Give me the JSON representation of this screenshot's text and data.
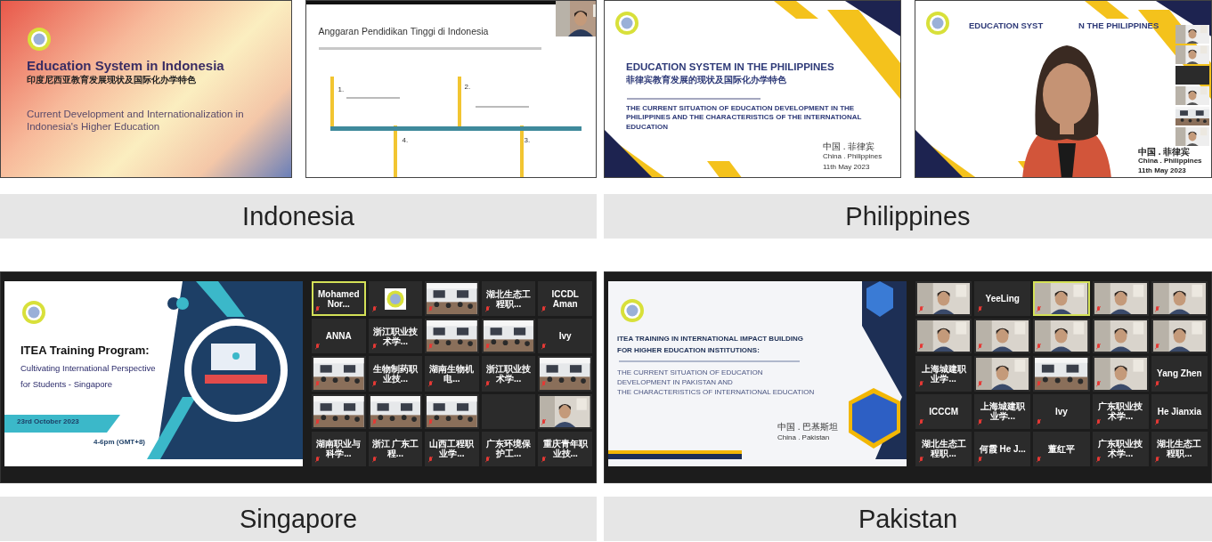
{
  "panels": [
    {
      "caption": "Indonesia",
      "frames": [
        {
          "kind": "gradient-title",
          "title": "Education System in Indonesia",
          "title_cn": "印度尼西亚教育发展现状及国际化办学特色",
          "subtitle": "Current Development and Internationalization in Indonesia's Higher Education"
        },
        {
          "kind": "timeline",
          "title": "Anggaran Pendidikan Tinggi di Indonesia",
          "steps": [
            "1.",
            "2.",
            "4.",
            "3."
          ]
        }
      ]
    },
    {
      "caption": "Philippines",
      "frames": [
        {
          "kind": "banner-title",
          "title": "EDUCATION SYSTEM IN THE PHILIPPINES",
          "title_cn": "菲律宾教育发展的现状及国际化办学特色",
          "subtitle": "THE CURRENT SITUATION OF EDUCATION DEVELOPMENT IN THE PHILIPPINES AND THE CHARACTERISTICS OF THE INTERNATIONAL EDUCATION",
          "footer": [
            "中国 . 菲律宾",
            "China . Philippines",
            "11th May 2023"
          ]
        },
        {
          "kind": "speaker",
          "title": "EDUCATION SYST",
          "title_end": "N THE PHILIPPINES",
          "footer": [
            "中国 . 菲律宾",
            "China . Philippines",
            "11th May 2023"
          ]
        }
      ]
    },
    {
      "caption": "Singapore",
      "frames": [
        {
          "kind": "meeting",
          "slide": {
            "kind": "program",
            "title": "ITEA Training Program:",
            "lines": [
              "Cultivating International Perspective",
              "for Students - Singapore"
            ],
            "date": "23rd October 2023",
            "time": "4-6pm (GMT+8)"
          },
          "tiles": [
            {
              "kind": "name",
              "name": "Mohamed Nor...",
              "highlighted": true
            },
            {
              "kind": "logo",
              "highlighted": false
            },
            {
              "kind": "room",
              "highlighted": false
            },
            {
              "kind": "name",
              "name": "湖北生态工程职...",
              "highlighted": false
            },
            {
              "kind": "name",
              "name": "ICCDL Aman",
              "highlighted": false
            },
            {
              "kind": "name",
              "name": "ANNA",
              "highlighted": false
            },
            {
              "kind": "name",
              "name": "浙江职业技术学...",
              "highlighted": false
            },
            {
              "kind": "room",
              "highlighted": false
            },
            {
              "kind": "room",
              "highlighted": false
            },
            {
              "kind": "name",
              "name": "Ivy",
              "highlighted": false
            },
            {
              "kind": "room",
              "highlighted": false
            },
            {
              "kind": "name",
              "name": "生物制药职业技...",
              "highlighted": false
            },
            {
              "kind": "name",
              "name": "湖南生物机电...",
              "highlighted": false
            },
            {
              "kind": "name",
              "name": "浙江职业技术学...",
              "highlighted": false
            },
            {
              "kind": "room",
              "highlighted": false
            },
            {
              "kind": "room",
              "highlighted": false
            },
            {
              "kind": "room",
              "highlighted": false
            },
            {
              "kind": "room",
              "highlighted": false
            },
            {
              "kind": "empty",
              "highlighted": false
            },
            {
              "kind": "person",
              "highlighted": false
            },
            {
              "kind": "name",
              "name": "湖南职业与科学...",
              "highlighted": false
            },
            {
              "kind": "name",
              "name": "浙江 广东工程...",
              "highlighted": false
            },
            {
              "kind": "name",
              "name": "山西工程职业学...",
              "highlighted": false
            },
            {
              "kind": "name",
              "name": "广东环境保护工...",
              "highlighted": false
            },
            {
              "kind": "name",
              "name": "重庆青年职业技...",
              "highlighted": false
            }
          ]
        }
      ]
    },
    {
      "caption": "Pakistan",
      "frames": [
        {
          "kind": "meeting",
          "slide": {
            "kind": "impact",
            "title": "ITEA TRAINING IN INTERNATIONAL IMPACT BUILDING",
            "title2": "FOR HIGHER EDUCATION INSTITUTIONS:",
            "lines": [
              "THE CURRENT SITUATION OF EDUCATION",
              "DEVELOPMENT IN PAKISTAN AND",
              "THE CHARACTERISTICS OF INTERNATIONAL EDUCATION"
            ],
            "footer": [
              "中国 . 巴基斯坦",
              "China . Pakistan"
            ]
          },
          "tiles": [
            {
              "kind": "person",
              "highlighted": false
            },
            {
              "kind": "name",
              "name": "YeeLing",
              "highlighted": false
            },
            {
              "kind": "person",
              "highlighted": true
            },
            {
              "kind": "person",
              "highlighted": false
            },
            {
              "kind": "person",
              "highlighted": false
            },
            {
              "kind": "person",
              "highlighted": false
            },
            {
              "kind": "person",
              "highlighted": false
            },
            {
              "kind": "person",
              "highlighted": false
            },
            {
              "kind": "person",
              "highlighted": false
            },
            {
              "kind": "person",
              "highlighted": false
            },
            {
              "kind": "name",
              "name": "上海城建职业学...",
              "highlighted": false
            },
            {
              "kind": "person",
              "highlighted": false
            },
            {
              "kind": "room",
              "highlighted": false
            },
            {
              "kind": "person",
              "highlighted": false
            },
            {
              "kind": "name",
              "name": "Yang Zhen",
              "highlighted": false
            },
            {
              "kind": "name",
              "name": "ICCCM",
              "highlighted": false
            },
            {
              "kind": "name",
              "name": "上海城建职业学...",
              "highlighted": false
            },
            {
              "kind": "name",
              "name": "Ivy",
              "highlighted": false
            },
            {
              "kind": "name",
              "name": "广东职业技术学...",
              "highlighted": false
            },
            {
              "kind": "name",
              "name": "He Jianxia",
              "highlighted": false
            },
            {
              "kind": "name",
              "name": "湖北生态工程职...",
              "highlighted": false
            },
            {
              "kind": "name",
              "name": "何霞 He J...",
              "highlighted": false
            },
            {
              "kind": "name",
              "name": "董红平",
              "highlighted": false
            },
            {
              "kind": "name",
              "name": "广东职业技术学...",
              "highlighted": false
            },
            {
              "kind": "name",
              "name": "湖北生态工程职...",
              "highlighted": false
            }
          ]
        }
      ]
    }
  ]
}
